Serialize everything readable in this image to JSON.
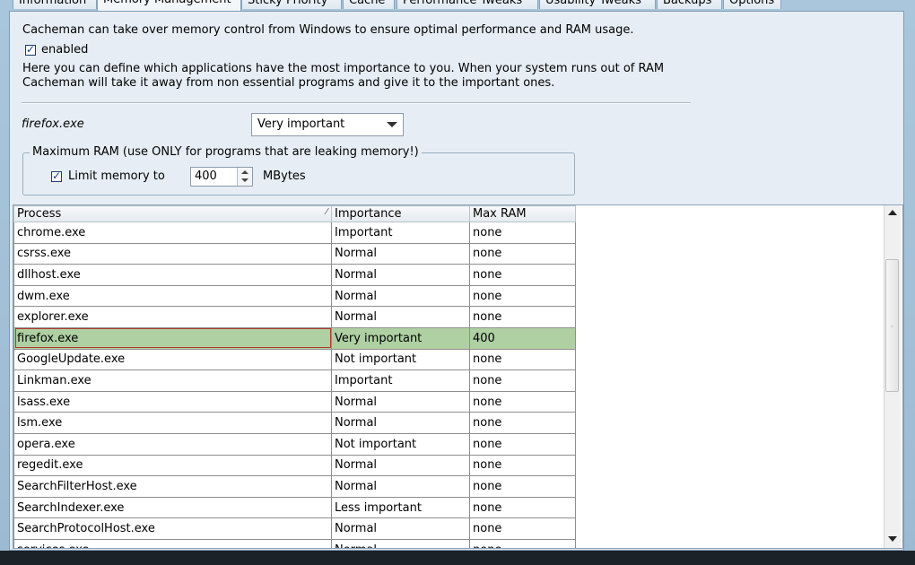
{
  "tabs": [
    {
      "label": "Information"
    },
    {
      "label": "Memory Management",
      "active": true
    },
    {
      "label": "Sticky Priority"
    },
    {
      "label": "Cache"
    },
    {
      "label": "Performance Tweaks"
    },
    {
      "label": "Usability Tweaks"
    },
    {
      "label": "Backups"
    },
    {
      "label": "Options"
    }
  ],
  "memory": {
    "intro": "Cacheman can take over memory control from Windows to ensure optimal performance and RAM usage.",
    "enabled_label": "enabled",
    "enabled_checked": true,
    "description_line1": "Here you can define which applications have the most importance to you. When your system runs out of RAM",
    "description_line2": "Cacheman will take it away from non essential programs and give it to the important ones.",
    "selected_process": "firefox.exe",
    "importance_value": "Very important",
    "group_title": "Maximum RAM (use ONLY for programs that are leaking memory!)",
    "limit_label": "Limit memory to",
    "limit_checked": true,
    "limit_value": "400",
    "limit_unit": "MBytes"
  },
  "table": {
    "columns": [
      "Process",
      "Importance",
      "Max RAM"
    ],
    "sort_mark": "⁄",
    "rows": [
      [
        "chrome.exe",
        "Important",
        "none"
      ],
      [
        "csrss.exe",
        "Normal",
        "none"
      ],
      [
        "dllhost.exe",
        "Normal",
        "none"
      ],
      [
        "dwm.exe",
        "Normal",
        "none"
      ],
      [
        "explorer.exe",
        "Normal",
        "none"
      ],
      [
        "firefox.exe",
        "Very important",
        "400"
      ],
      [
        "GoogleUpdate.exe",
        "Not important",
        "none"
      ],
      [
        "Linkman.exe",
        "Important",
        "none"
      ],
      [
        "lsass.exe",
        "Normal",
        "none"
      ],
      [
        "lsm.exe",
        "Normal",
        "none"
      ],
      [
        "opera.exe",
        "Not important",
        "none"
      ],
      [
        "regedit.exe",
        "Normal",
        "none"
      ],
      [
        "SearchFilterHost.exe",
        "Normal",
        "none"
      ],
      [
        "SearchIndexer.exe",
        "Less important",
        "none"
      ],
      [
        "SearchProtocolHost.exe",
        "Normal",
        "none"
      ],
      [
        "services.exe",
        "Normal",
        "none"
      ]
    ],
    "selected_row": "firefox.exe"
  },
  "colors": {
    "selected_row": "#aed0a2",
    "focus_border": "#b23a2d",
    "window_frame": "#9cbad2"
  },
  "icons": {
    "checkbox": "check-icon",
    "dropdown": "chevron-down-icon",
    "spin_up": "spin-up-icon",
    "spin_down": "spin-down-icon",
    "scroll_up": "scroll-up-icon",
    "scroll_down": "scroll-down-icon"
  }
}
